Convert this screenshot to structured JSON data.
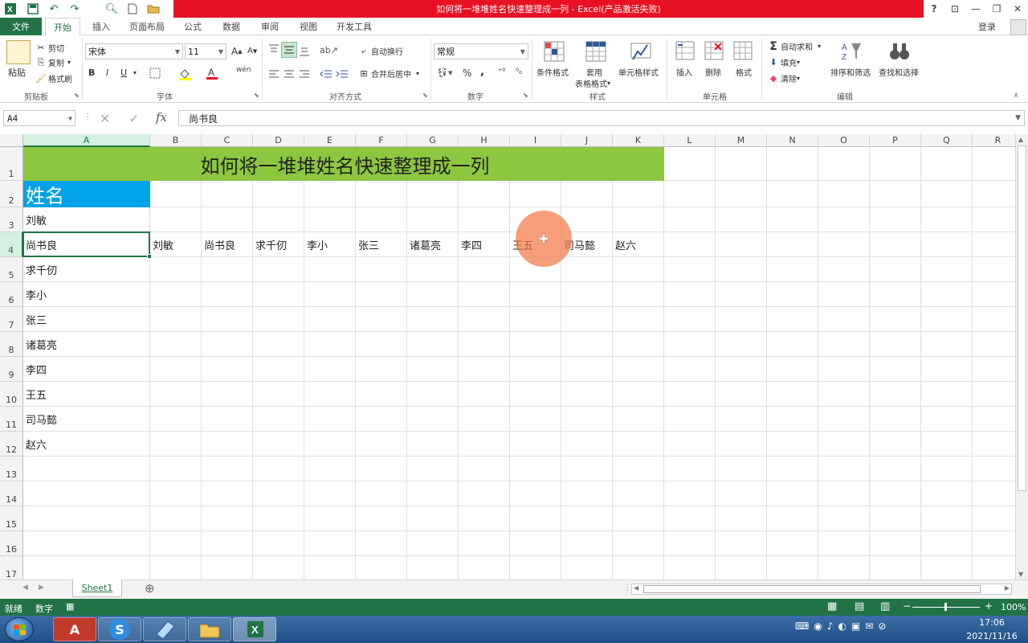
{
  "window": {
    "title": "如何将一堆堆姓名快速整理成一列 - Excel(产品激活失败)",
    "help": "?",
    "ribbon_display": "⊡",
    "minimize": "—",
    "restore": "❐",
    "close": "✕"
  },
  "tabs": [
    "开始",
    "插入",
    "页面布局",
    "公式",
    "数据",
    "审阅",
    "视图",
    "开发工具"
  ],
  "file_tab": "文件",
  "login": "登录",
  "ribbon": {
    "clipboard": {
      "paste": "粘贴",
      "cut": "剪切",
      "copy": "复制",
      "format_painter": "格式刷",
      "label": "剪贴板"
    },
    "font": {
      "name": "宋体",
      "size": "11",
      "bold": "B",
      "italic": "I",
      "underline": "U",
      "label": "字体",
      "grow": "A",
      "shrink": "A",
      "wen": "wén"
    },
    "alignment": {
      "wrap": "自动换行",
      "merge": "合并后居中",
      "label": "对齐方式"
    },
    "number": {
      "format": "常规",
      "percent": "%",
      "comma": ",",
      "inc_decimal": "⁺⁰",
      "dec_decimal": "⁰₀",
      "label": "数字"
    },
    "styles": {
      "conditional": "条件格式",
      "table_line1": "套用",
      "table_line2": "表格格式",
      "cell_styles": "单元格样式",
      "label": "样式"
    },
    "cells": {
      "insert": "插入",
      "delete": "删除",
      "format": "格式",
      "label": "单元格"
    },
    "editing": {
      "autosum": "自动求和",
      "fill": "填充",
      "clear": "清除",
      "sort": "排序和筛选",
      "find": "查找和选择",
      "label": "编辑"
    }
  },
  "formula_bar": {
    "name_box": "A4",
    "fx": "fx",
    "value": "尚书良"
  },
  "columns": [
    "A",
    "B",
    "C",
    "D",
    "E",
    "F",
    "G",
    "H",
    "I",
    "J",
    "K",
    "L",
    "M",
    "N",
    "O",
    "P",
    "Q",
    "R"
  ],
  "rows": [
    "1",
    "2",
    "3",
    "4",
    "5",
    "6",
    "7",
    "8",
    "9",
    "10",
    "11",
    "12",
    "13",
    "14",
    "15",
    "16",
    "17"
  ],
  "cells": {
    "title": "如何将一堆堆姓名快速整理成一列",
    "header": "姓名",
    "column_a": [
      "刘敏",
      "尚书良",
      "求千仞",
      "李小",
      "张三",
      "诸葛亮",
      "李四",
      "王五",
      "司马懿",
      "赵六"
    ],
    "row4": [
      "刘敏",
      "尚书良",
      "求千仞",
      "李小",
      "张三",
      "诸葛亮",
      "李四",
      "王五",
      "司马懿",
      "赵六"
    ]
  },
  "colors": {
    "title_fill": "#8dc63f",
    "header_fill": "#00a2e8",
    "excel_green": "#217346",
    "highlight": "#f47848"
  },
  "sheet": {
    "name": "Sheet1",
    "add": "⊕"
  },
  "status": {
    "mode": "就绪",
    "numlock": "数字",
    "zoom": "100%"
  },
  "clock": {
    "time": "17:06",
    "date": "2021/11/16"
  }
}
